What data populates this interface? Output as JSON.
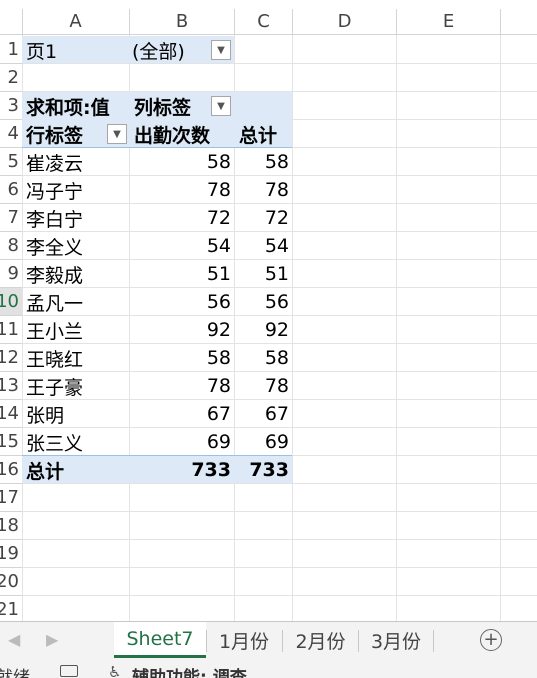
{
  "columns": [
    "A",
    "B",
    "C",
    "D",
    "E"
  ],
  "rows": [
    "1",
    "2",
    "3",
    "4",
    "5",
    "6",
    "7",
    "8",
    "9",
    "10",
    "11",
    "12",
    "13",
    "14",
    "15",
    "16",
    "17",
    "18",
    "19",
    "20",
    "21"
  ],
  "selected_row": "10",
  "filter": {
    "label": "页1",
    "value": "(全部)"
  },
  "pivot": {
    "sum_label": "求和项:值",
    "col_label": "列标签",
    "row_label": "行标签",
    "col_attendance": "出勤次数",
    "col_total": "总计",
    "data": [
      {
        "name": "崔凌云",
        "count": "58",
        "total": "58"
      },
      {
        "name": "冯子宁",
        "count": "78",
        "total": "78"
      },
      {
        "name": "李白宁",
        "count": "72",
        "total": "72"
      },
      {
        "name": "李全义",
        "count": "54",
        "total": "54"
      },
      {
        "name": "李毅成",
        "count": "51",
        "total": "51"
      },
      {
        "name": "孟凡一",
        "count": "56",
        "total": "56"
      },
      {
        "name": "王小兰",
        "count": "92",
        "total": "92"
      },
      {
        "name": "王晓红",
        "count": "58",
        "total": "58"
      },
      {
        "name": "王子豪",
        "count": "78",
        "total": "78"
      },
      {
        "name": "张明",
        "count": "67",
        "total": "67"
      },
      {
        "name": "张三义",
        "count": "69",
        "total": "69"
      }
    ],
    "grand_label": "总计",
    "grand_count": "733",
    "grand_total": "733"
  },
  "sheets": [
    "Sheet7",
    "1月份",
    "2月份",
    "3月份"
  ],
  "active_sheet": "Sheet7",
  "status": {
    "ready": "就绪",
    "accessibility": "辅助功能: 调查"
  },
  "icons": {
    "nav_prev": "chevron-left-icon",
    "nav_next": "chevron-right-icon",
    "add_sheet": "plus-circle-icon",
    "filter": "dropdown-arrow-icon"
  }
}
